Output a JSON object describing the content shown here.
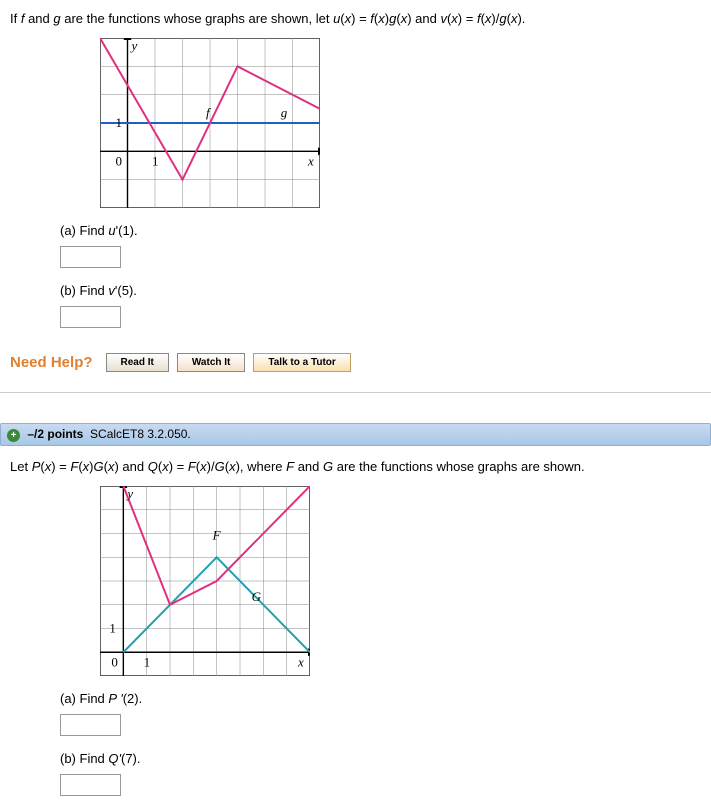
{
  "q1": {
    "prompt_html": "If <span class='italic'>f</span> and <span class='italic'>g</span> are the functions whose graphs are shown, let <span class='italic'>u</span>(<span class='italic'>x</span>) = <span class='italic'>f</span>(<span class='italic'>x</span>)<span class='italic'>g</span>(<span class='italic'>x</span>) and <span class='italic'>v</span>(<span class='italic'>x</span>) = <span class='italic'>f</span>(<span class='italic'>x</span>)/<span class='italic'>g</span>(<span class='italic'>x</span>).",
    "part_a_html": "(a) Find <span class='italic'>u</span>'(1).",
    "part_b_html": "(b) Find <span class='italic'>v</span>'(5).",
    "graph": {
      "xrange": [
        -1,
        7
      ],
      "yrange": [
        -2,
        4
      ],
      "labels": {
        "y": "y",
        "x": "x",
        "f": "f",
        "g": "g",
        "one": "1",
        "zero": "0",
        "xtick": "1"
      },
      "f_points": [
        [
          -1,
          4
        ],
        [
          2,
          -1
        ],
        [
          4,
          3
        ],
        [
          7,
          1.5
        ]
      ],
      "g_points": [
        [
          -1,
          1
        ],
        [
          7,
          1
        ]
      ],
      "f_color": "#e03080",
      "g_color": "#2060c0"
    }
  },
  "help": {
    "label": "Need Help?",
    "read": "Read It",
    "watch": "Watch It",
    "tutor": "Talk to a Tutor"
  },
  "q2": {
    "header_points": "–/2 points",
    "header_ref": "SCalcET8 3.2.050.",
    "prompt_html": "Let <span class='italic'>P</span>(<span class='italic'>x</span>) = <span class='italic'>F</span>(<span class='italic'>x</span>)<span class='italic'>G</span>(<span class='italic'>x</span>) and <span class='italic'>Q</span>(<span class='italic'>x</span>) = <span class='italic'>F</span>(<span class='italic'>x</span>)/<span class='italic'>G</span>(<span class='italic'>x</span>), where <span class='italic'>F</span> and <span class='italic'>G</span> are the functions whose graphs are shown.",
    "part_a_html": "(a) Find <span class='italic'>P '</span>(2).",
    "part_b_html": "(b) Find <span class='italic'>Q'</span>(7).",
    "graph": {
      "xrange": [
        -1,
        8
      ],
      "yrange": [
        -1,
        7
      ],
      "labels": {
        "y": "y",
        "x": "x",
        "F": "F",
        "G": "G",
        "one": "1",
        "zero": "0",
        "xtick": "1"
      },
      "F_points": [
        [
          0,
          7
        ],
        [
          2,
          2
        ],
        [
          4,
          3
        ],
        [
          8,
          7
        ]
      ],
      "G_points": [
        [
          0,
          0
        ],
        [
          4,
          4
        ],
        [
          8,
          0
        ]
      ],
      "F_color": "#e03080",
      "G_color": "#20a0b0"
    }
  },
  "chart_data": [
    {
      "type": "line",
      "title": "Problem 1 graph: f and g",
      "xlabel": "x",
      "ylabel": "y",
      "xlim": [
        -1,
        7
      ],
      "ylim": [
        -2,
        4
      ],
      "series": [
        {
          "name": "f",
          "points": [
            [
              -1,
              4
            ],
            [
              2,
              -1
            ],
            [
              4,
              3
            ],
            [
              7,
              1.5
            ]
          ],
          "color": "#e03080"
        },
        {
          "name": "g",
          "points": [
            [
              -1,
              1
            ],
            [
              7,
              1
            ]
          ],
          "color": "#2060c0"
        }
      ]
    },
    {
      "type": "line",
      "title": "Problem 2 graph: F and G",
      "xlabel": "x",
      "ylabel": "y",
      "xlim": [
        -1,
        8
      ],
      "ylim": [
        -1,
        7
      ],
      "series": [
        {
          "name": "F",
          "points": [
            [
              0,
              7
            ],
            [
              2,
              2
            ],
            [
              4,
              3
            ],
            [
              8,
              7
            ]
          ],
          "color": "#e03080"
        },
        {
          "name": "G",
          "points": [
            [
              0,
              0
            ],
            [
              4,
              4
            ],
            [
              8,
              0
            ]
          ],
          "color": "#20a0b0"
        }
      ]
    }
  ]
}
